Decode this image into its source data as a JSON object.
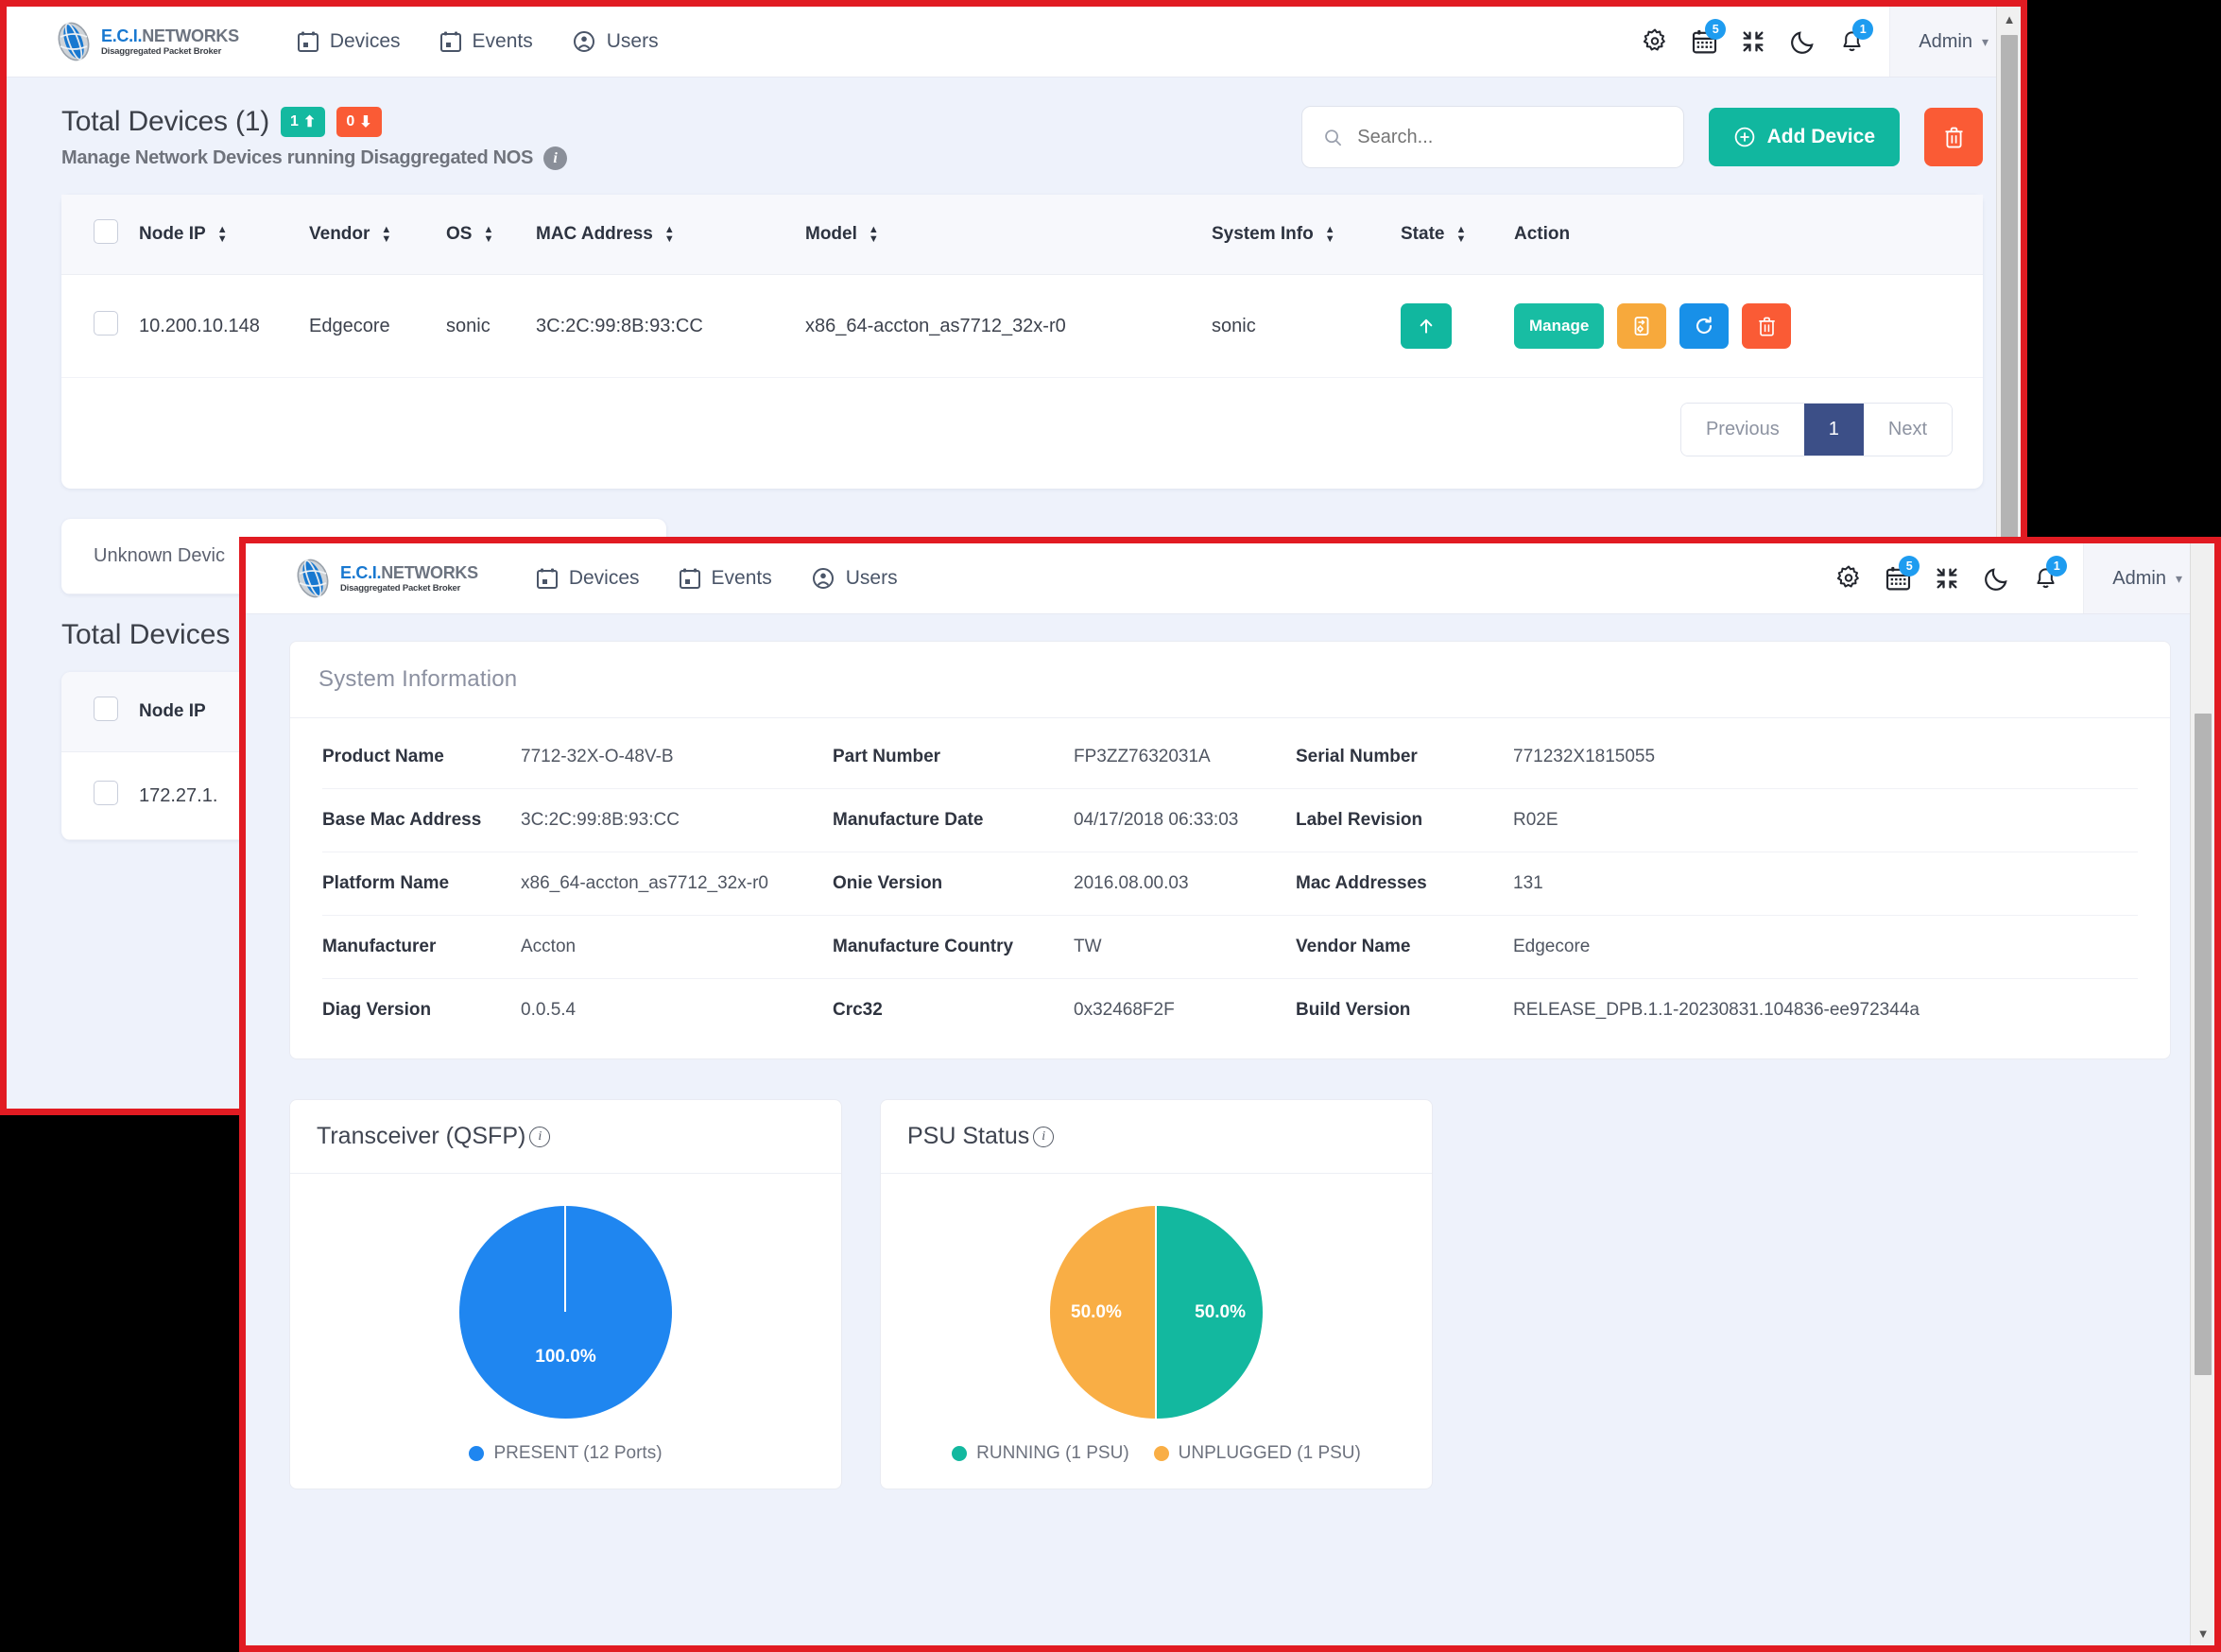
{
  "brand": {
    "line1_a": "E.C.I.",
    "line1_b": "NETWORKS",
    "tagline": "Disaggregated Packet Broker",
    "logo_icon": "globe-sphere-logo"
  },
  "nav": {
    "items": [
      {
        "label": "Devices",
        "icon": "calendar-device-icon"
      },
      {
        "label": "Events",
        "icon": "calendar-event-icon"
      },
      {
        "label": "Users",
        "icon": "user-circle-icon"
      }
    ],
    "icons": [
      {
        "name": "settings-gear-icon",
        "badge": null
      },
      {
        "name": "calendar-icon",
        "badge": "5"
      },
      {
        "name": "compress-icon",
        "badge": null
      },
      {
        "name": "dark-mode-moon-icon",
        "badge": null
      },
      {
        "name": "notification-bell-icon",
        "badge": "1"
      }
    ],
    "account_label": "Admin",
    "caret_icon": "chevron-down-icon"
  },
  "devices_page": {
    "title": "Total Devices (1)",
    "pill_up": "1",
    "pill_up_icon": "arrow-up",
    "pill_down": "0",
    "pill_down_icon": "arrow-down",
    "subtitle": "Manage Network Devices running Disaggregated NOS",
    "info_icon": "info-icon",
    "search_placeholder": "Search...",
    "search_value": "",
    "add_button": "Add Device",
    "add_icon": "plus-circle-icon",
    "delete_icon": "trash-icon",
    "columns": [
      "Node IP",
      "Vendor",
      "OS",
      "MAC Address",
      "Model",
      "System Info",
      "State",
      "Action"
    ],
    "rows": [
      {
        "node_ip": "10.200.10.148",
        "vendor": "Edgecore",
        "os": "sonic",
        "mac": "3C:2C:99:8B:93:CC",
        "model": "x86_64-accton_as7712_32x-r0",
        "system_info": "sonic",
        "state_icon": "arrow-up-icon",
        "manage_label": "Manage",
        "config_icon": "device-config-icon",
        "refresh_icon": "refresh-icon",
        "delete_icon": "trash-icon"
      }
    ],
    "pagination": {
      "previous": "Previous",
      "pages": [
        "1"
      ],
      "active": "1",
      "next": "Next"
    }
  },
  "lower_section": {
    "tab_label": "Unknown Devic",
    "title": "Total Devices",
    "column": "Node IP",
    "row_ip": "172.27.1."
  },
  "modal": {
    "system_information": {
      "heading": "System Information",
      "rows": [
        [
          {
            "key": "Product Name",
            "value": "7712-32X-O-48V-B"
          },
          {
            "key": "Part Number",
            "value": "FP3ZZ7632031A"
          },
          {
            "key": "Serial Number",
            "value": "771232X1815055"
          }
        ],
        [
          {
            "key": "Base Mac Address",
            "value": "3C:2C:99:8B:93:CC"
          },
          {
            "key": "Manufacture Date",
            "value": "04/17/2018 06:33:03"
          },
          {
            "key": "Label Revision",
            "value": "R02E"
          }
        ],
        [
          {
            "key": "Platform Name",
            "value": "x86_64-accton_as7712_32x-r0"
          },
          {
            "key": "Onie Version",
            "value": "2016.08.00.03"
          },
          {
            "key": "Mac Addresses",
            "value": "131"
          }
        ],
        [
          {
            "key": "Manufacturer",
            "value": "Accton"
          },
          {
            "key": "Manufacture Country",
            "value": "TW"
          },
          {
            "key": "Vendor Name",
            "value": "Edgecore"
          }
        ],
        [
          {
            "key": "Diag Version",
            "value": "0.0.5.4"
          },
          {
            "key": "Crc32",
            "value": "0x32468F2F"
          },
          {
            "key": "Build Version",
            "value": "RELEASE_DPB.1.1-20230831.104836-ee972344a"
          }
        ]
      ]
    },
    "transceiver_chart": {
      "title": "Transceiver (QSFP)",
      "info_icon": "info-icon",
      "center_label": "100.0%",
      "legend": [
        {
          "label": "PRESENT (12 Ports)",
          "color": "#1f86f0"
        }
      ]
    },
    "psu_chart": {
      "title": "PSU Status",
      "info_icon": "info-icon",
      "label_left": "50.0%",
      "label_right": "50.0%",
      "legend": [
        {
          "label": "RUNNING (1 PSU)",
          "color": "#13b89f"
        },
        {
          "label": "UNPLUGGED (1 PSU)",
          "color": "#f9ae45"
        }
      ]
    }
  },
  "colors": {
    "brand_blue": "#1878d0",
    "accent_teal": "#11b79f",
    "accent_orange": "#fa5b35",
    "accent_blue": "#1890e8",
    "pager_active": "#3c4f87",
    "window_border": "#e11b22"
  },
  "chart_data": [
    {
      "type": "pie",
      "title": "Transceiver (QSFP)",
      "categories": [
        "PRESENT (12 Ports)"
      ],
      "values": [
        100.0
      ],
      "labels": [
        "100.0%"
      ],
      "colors": [
        "#1f86f0"
      ],
      "legend_position": "bottom"
    },
    {
      "type": "pie",
      "title": "PSU Status",
      "categories": [
        "RUNNING (1 PSU)",
        "UNPLUGGED (1 PSU)"
      ],
      "values": [
        50.0,
        50.0
      ],
      "labels": [
        "50.0%",
        "50.0%"
      ],
      "colors": [
        "#13b89f",
        "#f9ae45"
      ],
      "legend_position": "bottom"
    }
  ]
}
